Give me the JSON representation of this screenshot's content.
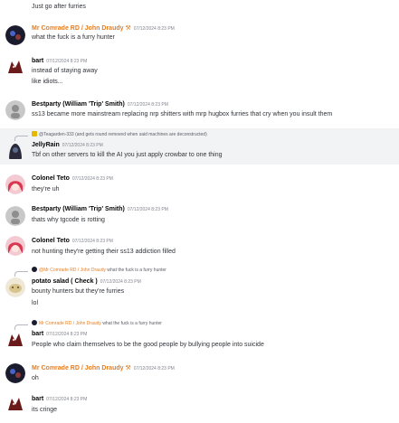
{
  "messages": [
    {
      "continuation": true,
      "text": "Just go after furries"
    },
    {
      "author": "Mr Comrade RD / John Draudy",
      "author_color": "#e67e22",
      "badge_icon": "wrench-icon",
      "timestamp": "07/12/2024 8:23 PM",
      "lines": [
        "what the fuck is a furry hunter"
      ],
      "avatar": "comrade"
    },
    {
      "author": "bart",
      "timestamp": "07/12/2024 8:23 PM",
      "lines": [
        "instead of staying away",
        "like idiots..."
      ],
      "avatar": "bart"
    },
    {
      "author": "Bestparty (William 'Trip' Smith)",
      "timestamp": "07/12/2024 8:23 PM",
      "lines": [
        "ss13 became more mainstream replacing nrp shitters with mrp hugbox furries that cry when you insult them"
      ],
      "avatar": "bestparty"
    },
    {
      "reply": {
        "name": "@Teagarden-333",
        "text": "(and gets round removed when said machines are deconstructed)"
      },
      "author": "JellyRain",
      "timestamp": "07/12/2024 8:23 PM",
      "lines": [
        "Tbf on other servers to kill the AI you just apply crowbar to one thing"
      ],
      "avatar": "jelly",
      "highlight": true
    },
    {
      "author": "Colonel Teto",
      "timestamp": "07/12/2024 8:23 PM",
      "lines": [
        "they're uh"
      ],
      "avatar": "teto"
    },
    {
      "author": "Bestparty (William 'Trip' Smith)",
      "timestamp": "07/12/2024 8:23 PM",
      "lines": [
        "thats why tgcode is rotting"
      ],
      "avatar": "bestparty"
    },
    {
      "author": "Colonel Teto",
      "timestamp": "07/12/2024 8:23 PM",
      "lines": [
        "not hunting they're getting their ss13 addiction filled"
      ],
      "avatar": "teto"
    },
    {
      "reply": {
        "name": "@Mr Comrade RD / John Draudy",
        "text": "what the fuck is a furry hunter"
      },
      "author": "potato salad ( Check )",
      "timestamp": "07/12/2024 8:23 PM",
      "lines": [
        "bounty hunters but they're furries",
        "lol"
      ],
      "avatar": "potato"
    },
    {
      "reply": {
        "name": "Mr Comrade RD / John Draudy",
        "text": "what the fuck is a furry hunter"
      },
      "author": "bart",
      "timestamp": "07/12/2024 8:23 PM",
      "lines": [
        "People who claim themselves to be the good people by bullying people into suicide"
      ],
      "avatar": "bart"
    },
    {
      "author": "Mr Comrade RD / John Draudy",
      "author_color": "#e67e22",
      "badge_icon": "wrench-icon",
      "timestamp": "07/12/2024 8:23 PM",
      "lines": [
        "oh"
      ],
      "avatar": "comrade"
    },
    {
      "author": "bart",
      "timestamp": "07/12/2024 8:23 PM",
      "lines": [
        "its cringe"
      ],
      "avatar": "bart"
    }
  ]
}
